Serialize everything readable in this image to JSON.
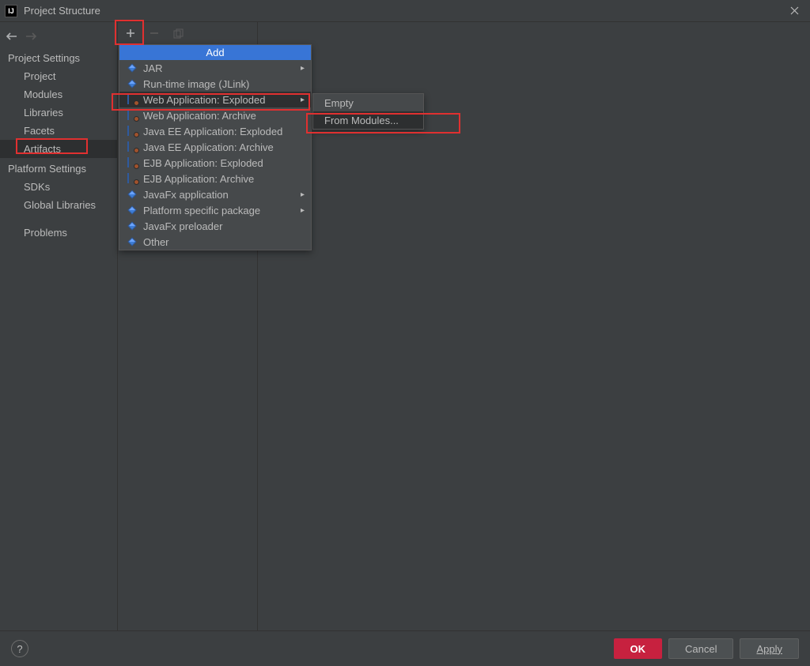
{
  "title": "Project Structure",
  "sidebar": {
    "project_settings_header": "Project Settings",
    "project": "Project",
    "modules": "Modules",
    "libraries": "Libraries",
    "facets": "Facets",
    "artifacts": "Artifacts",
    "platform_settings_header": "Platform Settings",
    "sdks": "SDKs",
    "global_libraries": "Global Libraries",
    "problems": "Problems"
  },
  "add_menu": {
    "header": "Add",
    "items": [
      {
        "label": "JAR",
        "arrow": true,
        "badge": false
      },
      {
        "label": "Run-time image (JLink)",
        "arrow": false,
        "badge": false
      },
      {
        "label": "Web Application: Exploded",
        "arrow": true,
        "badge": true,
        "highlighted": true
      },
      {
        "label": "Web Application: Archive",
        "arrow": false,
        "badge": true
      },
      {
        "label": "Java EE Application: Exploded",
        "arrow": false,
        "badge": true
      },
      {
        "label": "Java EE Application: Archive",
        "arrow": false,
        "badge": true
      },
      {
        "label": "EJB Application: Exploded",
        "arrow": false,
        "badge": true
      },
      {
        "label": "EJB Application: Archive",
        "arrow": false,
        "badge": true
      },
      {
        "label": "JavaFx application",
        "arrow": true,
        "badge": false
      },
      {
        "label": "Platform specific package",
        "arrow": true,
        "badge": false
      },
      {
        "label": "JavaFx preloader",
        "arrow": false,
        "badge": false
      },
      {
        "label": "Other",
        "arrow": false,
        "badge": false
      }
    ]
  },
  "submenu": {
    "empty": "Empty",
    "from_modules": "From Modules..."
  },
  "buttons": {
    "ok": "OK",
    "cancel": "Cancel",
    "apply": "Apply"
  }
}
